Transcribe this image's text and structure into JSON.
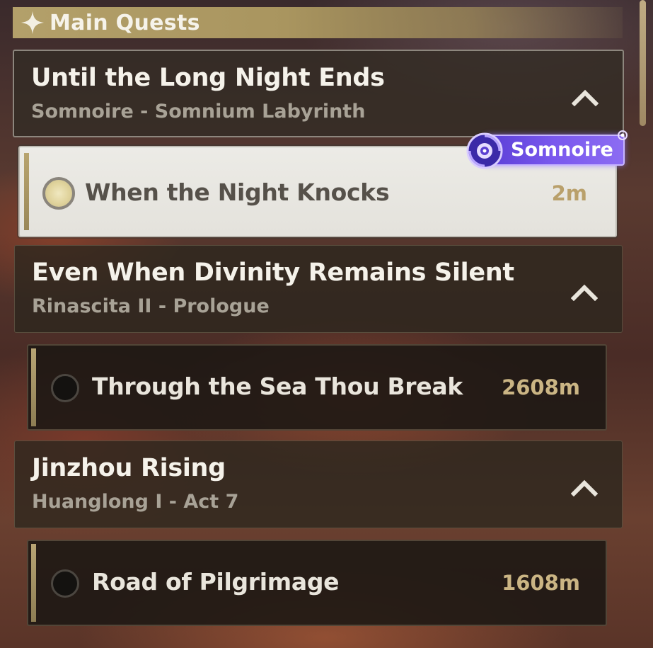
{
  "section": {
    "title": "Main Quests",
    "icon": "sparkle-star-icon"
  },
  "quests": [
    {
      "title": "Until the Long Night Ends",
      "subtitle": "Somnoire - Somnium Labyrinth",
      "expanded": true,
      "tasks": [
        {
          "name": "When the Night Knocks",
          "distance": "2m",
          "tracked": true,
          "badge": "Somnoire"
        }
      ]
    },
    {
      "title": "Even When Divinity Remains Silent",
      "subtitle": "Rinascita II - Prologue",
      "expanded": true,
      "tasks": [
        {
          "name": "Through the Sea Thou Break",
          "distance": "2608m",
          "tracked": false
        }
      ]
    },
    {
      "title": "Jinzhou Rising",
      "subtitle": "Huanglong I - Act 7",
      "expanded": true,
      "tasks": [
        {
          "name": "Road of Pilgrimage",
          "distance": "1608m",
          "tracked": false
        }
      ]
    }
  ],
  "colors": {
    "header_gold": "#b3a06a",
    "distance_gold": "#cbb584",
    "badge_purple": "#7a58ee"
  }
}
